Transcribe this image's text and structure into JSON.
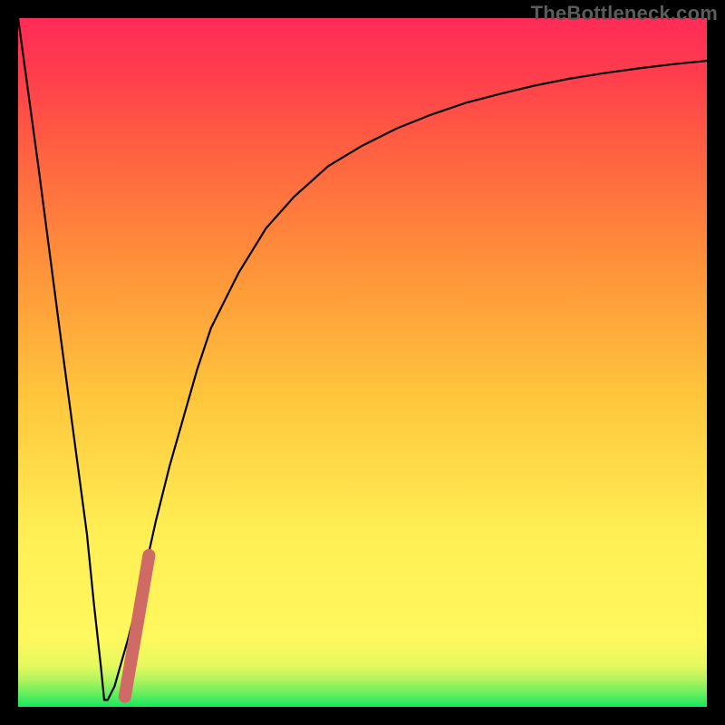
{
  "watermark": "TheBottleneck.com",
  "chart_data": {
    "type": "line",
    "title": "",
    "xlabel": "",
    "ylabel": "",
    "xlim": [
      0,
      100
    ],
    "ylim": [
      0,
      100
    ],
    "grid": false,
    "background": {
      "type": "vertical-gradient",
      "stops": [
        {
          "offset": 0.0,
          "color": "#14e85e"
        },
        {
          "offset": 0.02,
          "color": "#6aee5e"
        },
        {
          "offset": 0.04,
          "color": "#b2f45e"
        },
        {
          "offset": 0.06,
          "color": "#e6f95e"
        },
        {
          "offset": 0.1,
          "color": "#fff85e"
        },
        {
          "offset": 0.25,
          "color": "#ffef54"
        },
        {
          "offset": 0.45,
          "color": "#ffc63c"
        },
        {
          "offset": 0.65,
          "color": "#ff8f3a"
        },
        {
          "offset": 0.82,
          "color": "#ff5d42"
        },
        {
          "offset": 0.93,
          "color": "#ff3a4e"
        },
        {
          "offset": 1.0,
          "color": "#ff2c57"
        }
      ]
    },
    "series": [
      {
        "name": "bottleneck-curve",
        "color": "#000000",
        "x": [
          0,
          3,
          6,
          8,
          10,
          11,
          12,
          12.5,
          13,
          14,
          16,
          18,
          20,
          22,
          24,
          26,
          28,
          32,
          36,
          40,
          45,
          50,
          55,
          60,
          65,
          70,
          75,
          80,
          85,
          90,
          95,
          100
        ],
        "y": [
          100,
          78,
          55,
          40,
          25,
          15,
          6,
          1,
          1,
          3,
          10,
          18,
          27,
          35,
          42,
          49,
          55,
          63,
          69.5,
          74,
          78.5,
          81.5,
          84,
          86,
          87.7,
          89,
          90.2,
          91.2,
          92,
          92.7,
          93.3,
          93.8
        ]
      },
      {
        "name": "highlight-segment",
        "color": "#cf6a65",
        "stroke_width": 14,
        "x": [
          15.5,
          19.0
        ],
        "y": [
          1.5,
          22.0
        ]
      }
    ]
  }
}
